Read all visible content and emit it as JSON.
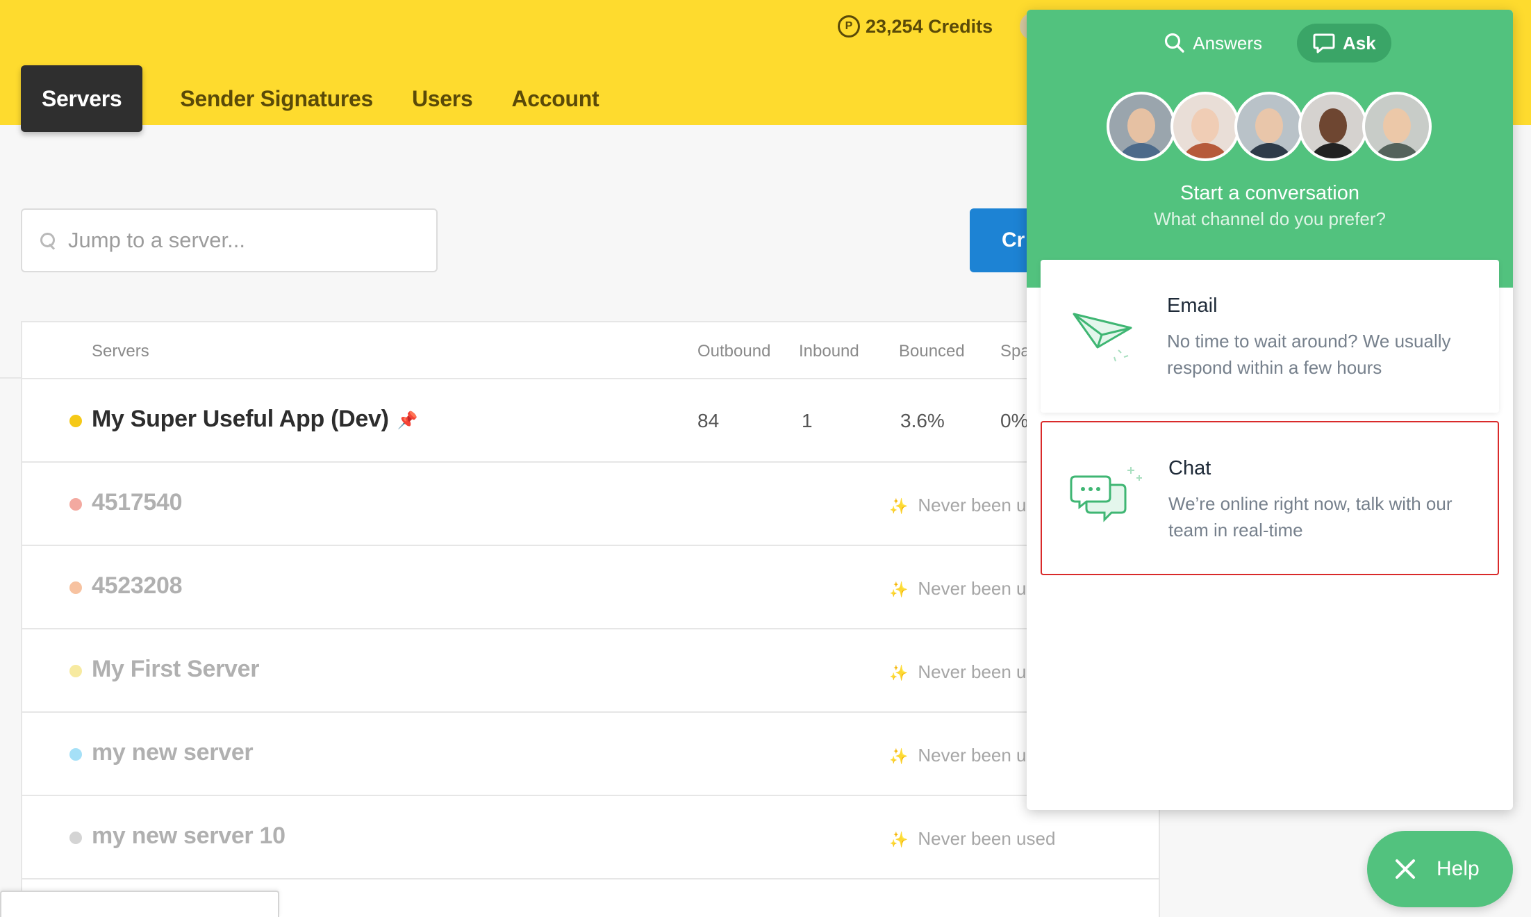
{
  "header": {
    "credits": "23,254 Credits",
    "credits_symbol": "P",
    "nav": [
      "Servers",
      "Sender Signatures",
      "Users",
      "Account"
    ]
  },
  "search": {
    "placeholder": "Jump to a server..."
  },
  "create_button": {
    "label": "Cr"
  },
  "table": {
    "headers": [
      "Servers",
      "Outbound",
      "Inbound",
      "Bounced",
      "Spa"
    ],
    "rows": [
      {
        "name": "My Super Useful App (Dev)",
        "dot_color": "#f5c917",
        "outbound": "84",
        "inbound": "1",
        "bounced": "3.6%",
        "spam": "0%"
      },
      {
        "name": "4517540",
        "dot_color": "#f3a9a0",
        "status": "Never been us"
      },
      {
        "name": "4523208",
        "dot_color": "#f7c2a0",
        "status": "Never been us"
      },
      {
        "name": "My First Server",
        "dot_color": "#f7eaa0",
        "status": "Never been us"
      },
      {
        "name": "my new server",
        "dot_color": "#a5e0f7",
        "status": "Never been us"
      },
      {
        "name": "my new server 10",
        "dot_color": "#d4d4d4",
        "status": "Never been used"
      }
    ]
  },
  "widget": {
    "tabs": [
      {
        "label": "Answers",
        "icon": "search-icon"
      },
      {
        "label": "Ask",
        "icon": "chat-bubble-icon"
      }
    ],
    "title": "Start a conversation",
    "subtitle": "What channel do you prefer?",
    "email": {
      "title": "Email",
      "desc": "No time to wait around? We usually respond within a few hours"
    },
    "chat": {
      "title": "Chat",
      "desc": "We’re online right now, talk with our team in real-time"
    }
  },
  "help_button": {
    "label": "Help"
  },
  "colors": {
    "header": "#fedb2e",
    "widget": "#52c27e",
    "create": "#1d83d4",
    "highlight": "#d92a2a"
  }
}
